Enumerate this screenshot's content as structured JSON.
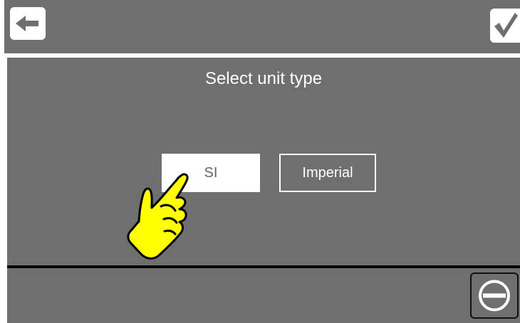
{
  "header": {
    "back_icon": "arrow-left-icon",
    "confirm_icon": "checkmark-icon"
  },
  "main": {
    "title": "Select unit type",
    "options": [
      {
        "label": "SI",
        "selected": true
      },
      {
        "label": "Imperial",
        "selected": false
      }
    ]
  },
  "footer": {
    "stop_icon": "stop-icon"
  },
  "overlay": {
    "pointer_icon": "pointing-hand-icon"
  },
  "colors": {
    "panel": "#6f6f6f",
    "text": "#ffffff",
    "hand_fill": "#ffff00",
    "hand_outline": "#000000"
  }
}
